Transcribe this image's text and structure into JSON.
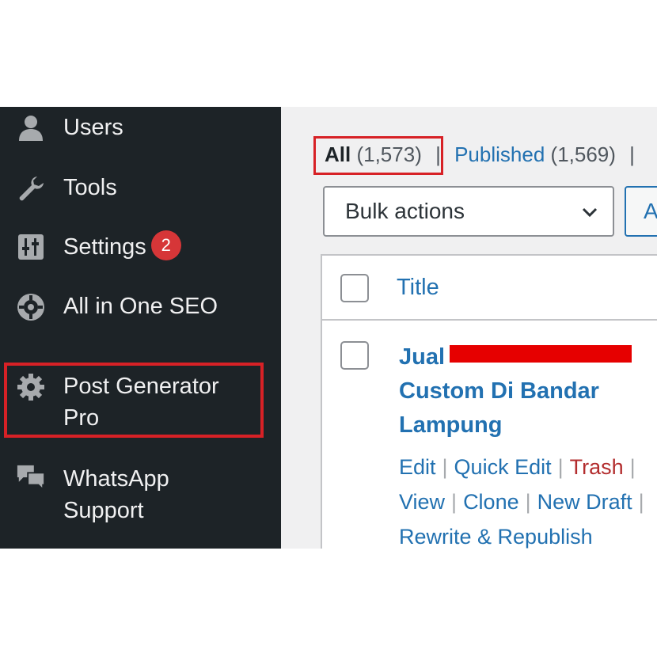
{
  "sidebar": {
    "items": [
      {
        "label": "Users",
        "icon": "users-icon"
      },
      {
        "label": "Tools",
        "icon": "wrench-icon"
      },
      {
        "label": "Settings",
        "icon": "settings-icon",
        "badge": "2"
      },
      {
        "label": "All in One SEO",
        "icon": "aioseo-icon"
      },
      {
        "label": "Post Generator Pro",
        "icon": "gear-icon",
        "highlighted": true
      },
      {
        "label": "WhatsApp Support",
        "icon": "chat-bubbles-icon"
      }
    ]
  },
  "filters": {
    "all_label": "All",
    "all_count": "(1,573)",
    "published_label": "Published",
    "published_count": "(1,569)",
    "separator": "|"
  },
  "bulk_actions": {
    "selected": "Bulk actions",
    "apply_partial": "A"
  },
  "table": {
    "columns": [
      "Title"
    ],
    "rows": [
      {
        "title_start": "Jual",
        "title_rest": "Custom Di Bandar Lampung",
        "actions": [
          "Edit",
          "Quick Edit",
          "Trash",
          "View",
          "Clone",
          "New Draft",
          "Rewrite & Republish"
        ]
      }
    ]
  },
  "colors": {
    "sidebar_bg": "#1d2327",
    "link": "#2271b1",
    "highlight_border": "#d72126",
    "trash": "#b32d2e",
    "badge": "#d63638"
  }
}
